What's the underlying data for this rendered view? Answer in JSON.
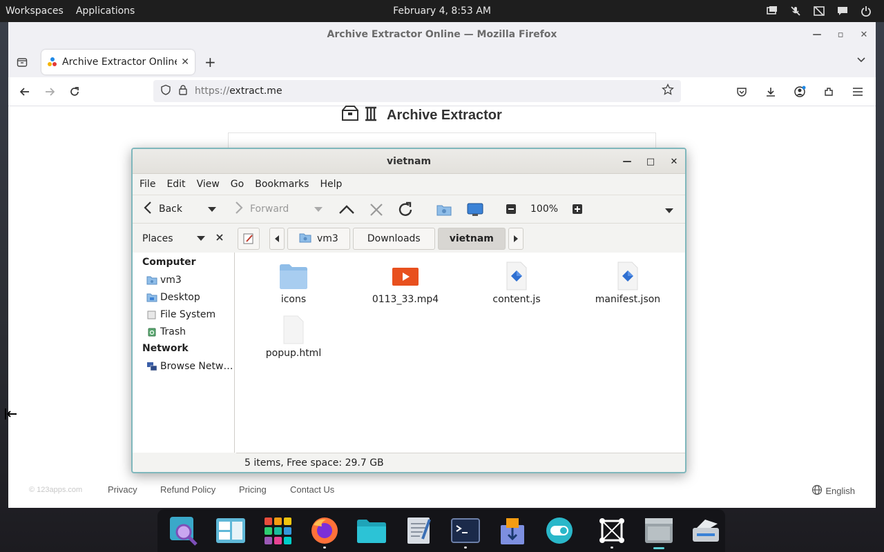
{
  "topbar": {
    "menu": [
      "Workspaces",
      "Applications"
    ],
    "clock": "February 4, 8:53 AM"
  },
  "firefox": {
    "title": "Archive Extractor Online — Mozilla Firefox",
    "tab_label": "Archive Extractor Online",
    "url_protocol": "https://",
    "url_host": "extract.me"
  },
  "page": {
    "brand": "Archive Extractor",
    "footer": {
      "copyright": "© 123apps.com",
      "links": [
        "Privacy",
        "Refund Policy",
        "Pricing",
        "Contact Us"
      ],
      "language": "English"
    }
  },
  "filemanager": {
    "title": "vietnam",
    "menu": [
      "File",
      "Edit",
      "View",
      "Go",
      "Bookmarks",
      "Help"
    ],
    "toolbar": {
      "back": "Back",
      "forward": "Forward",
      "zoom": "100%"
    },
    "places_label": "Places",
    "breadcrumbs": [
      "vm3",
      "Downloads",
      "vietnam"
    ],
    "sidebar": {
      "computer_header": "Computer",
      "computer_items": [
        "vm3",
        "Desktop",
        "File System",
        "Trash"
      ],
      "network_header": "Network",
      "network_items": [
        "Browse Netw…"
      ]
    },
    "files": [
      "icons",
      "0113_33.mp4",
      "content.js",
      "manifest.json",
      "popup.html"
    ],
    "status": "5 items, Free space: 29.7 GB"
  },
  "colors": {
    "window_border": "#7fb7bc",
    "folder": "#8fbde8",
    "accent": "#5fd1d6"
  }
}
